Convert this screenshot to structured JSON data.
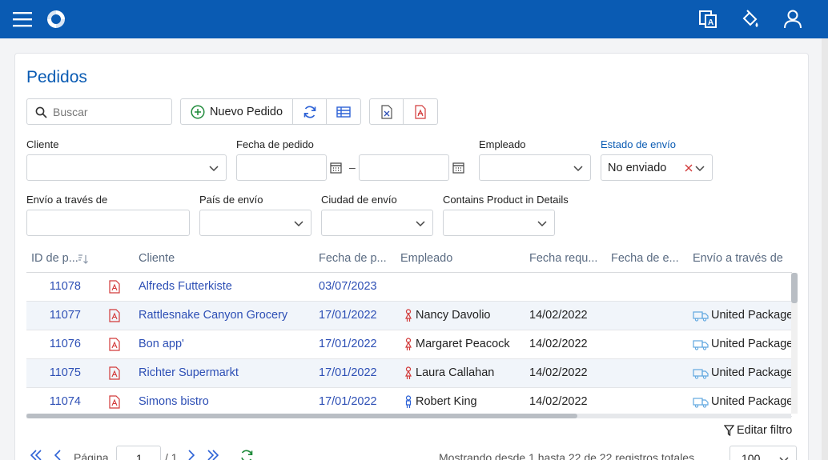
{
  "topbar": {
    "menu_icon": "hamburger-icon",
    "logo_icon": "swirl-logo-icon",
    "translate_icon": "translate-icon",
    "theme_icon": "paint-bucket-icon",
    "user_icon": "user-icon",
    "bg_color": "#0a5bb3"
  },
  "page": {
    "title": "Pedidos",
    "search_placeholder": "Buscar",
    "new_button_label": "Nuevo Pedido"
  },
  "filters": {
    "cliente_label": "Cliente",
    "fecha_label": "Fecha de pedido",
    "fecha_sep": "–",
    "empleado_label": "Empleado",
    "estado_label": "Estado de envío",
    "estado_value": "No enviado",
    "envio_label": "Envío a través de",
    "pais_label": "País de envío",
    "ciudad_label": "Ciudad de envío",
    "product_label": "Contains Product in Details"
  },
  "grid": {
    "columns": [
      "ID de p...",
      "Cliente",
      "Fecha de p...",
      "Empleado",
      "Fecha requ...",
      "Fecha de e...",
      "Envío a través de"
    ],
    "rows": [
      {
        "id": "11078",
        "cliente": "Alfreds Futterkiste",
        "fecha": "03/07/2023",
        "empleado": "",
        "requerida": "",
        "envio": ""
      },
      {
        "id": "11077",
        "cliente": "Rattlesnake Canyon Grocery",
        "fecha": "17/01/2022",
        "empleado": "Nancy Davolio",
        "requerida": "14/02/2022",
        "envio": "United Package"
      },
      {
        "id": "11076",
        "cliente": "Bon app'",
        "fecha": "17/01/2022",
        "empleado": "Margaret Peacock",
        "requerida": "14/02/2022",
        "envio": "United Package"
      },
      {
        "id": "11075",
        "cliente": "Richter Supermarkt",
        "fecha": "17/01/2022",
        "empleado": "Laura Callahan",
        "requerida": "14/02/2022",
        "envio": "United Package"
      },
      {
        "id": "11074",
        "cliente": "Simons bistro",
        "fecha": "17/01/2022",
        "empleado": "Robert King",
        "requerida": "14/02/2022",
        "envio": "United Package"
      }
    ]
  },
  "footer": {
    "edit_filter_label": "Editar filtro",
    "page_label": "Página",
    "page_value": "1",
    "page_total": "/ 1",
    "summary": "Mostrando desde 1 hasta 22 de 22 registros totales",
    "page_size": "100"
  }
}
